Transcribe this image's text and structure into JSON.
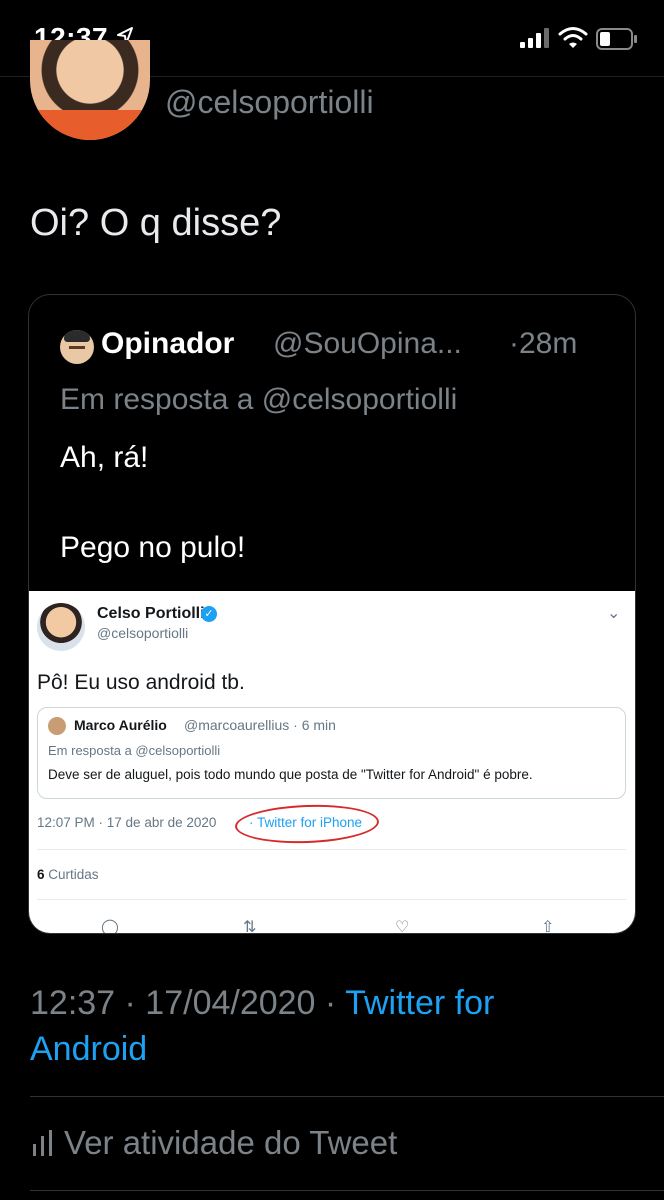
{
  "status_bar": {
    "time": "12:37"
  },
  "tweet": {
    "handle": "@celsoportiolli",
    "text": "Oi? O q disse?",
    "timestamp": "12:37 · 17/04/2020 · ",
    "source_part1": "Twitter for",
    "source_part2": "Android",
    "activity_label": "Ver atividade do Tweet"
  },
  "quoted": {
    "name": "Opinador",
    "handle": "@SouOpina...",
    "time": "·28m",
    "reply_to": "Em resposta a @celsoportiolli",
    "line1": "Ah, rá!",
    "line2": "Pego no pulo!"
  },
  "embedded": {
    "name": "Celso Portiolli",
    "handle": "@celsoportiolli",
    "text": "Pô! Eu uso android tb.",
    "quote_name": "Marco Aurélio",
    "quote_handle": "@marcoaurellius · 6 min",
    "quote_reply": "Em resposta a @celsoportiolli",
    "quote_text": "Deve ser de aluguel, pois todo mundo que posta de \"Twitter for Android\" é pobre.",
    "meta": "12:07 PM · 17 de abr de 2020",
    "source": "· Twitter for iPhone",
    "likes_count": "6",
    "likes_label": " Curtidas"
  },
  "colors": {
    "accent": "#1da1f2",
    "muted": "#7b8288",
    "background": "#000000"
  },
  "icons": [
    "location-arrow-icon",
    "signal-icon",
    "wifi-icon",
    "battery-icon",
    "verified-icon",
    "chevron-down-icon",
    "bar-chart-icon",
    "reply-icon",
    "retweet-icon",
    "like-icon",
    "share-icon"
  ]
}
